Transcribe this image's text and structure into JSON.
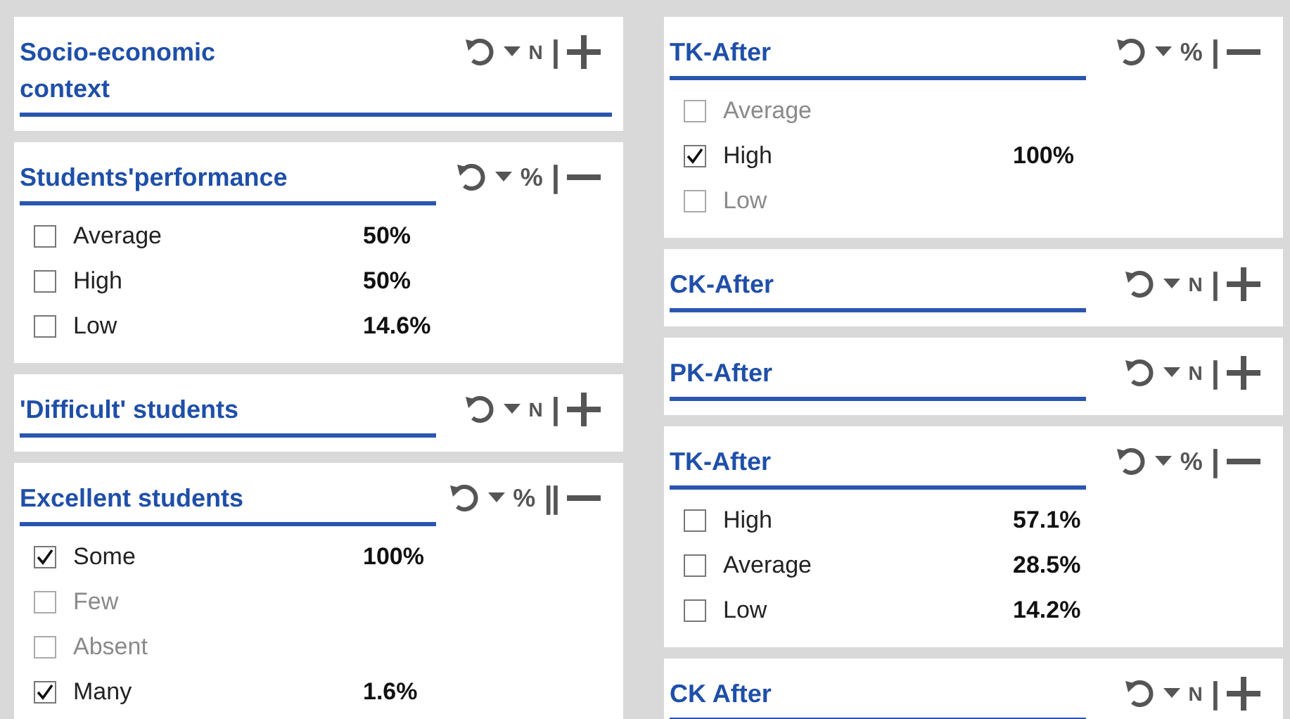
{
  "columns": [
    {
      "panels": [
        {
          "title": "Socio-economic context",
          "kind": "wrapped",
          "mode": "N",
          "separator": "|",
          "expanded": false
        },
        {
          "title": "Students'performance",
          "kind": "single",
          "mode": "%",
          "separator": "|",
          "expanded": true,
          "options": [
            {
              "label": "Average",
              "checked": false,
              "disabled": false,
              "value": "50%"
            },
            {
              "label": "High",
              "checked": false,
              "disabled": false,
              "value": "50%"
            },
            {
              "label": "Low",
              "checked": false,
              "disabled": false,
              "value": "14.6%"
            }
          ]
        },
        {
          "title": "'Difficult' students",
          "kind": "single",
          "mode": "N",
          "separator": "|",
          "expanded": false
        },
        {
          "title": "Excellent students",
          "kind": "single",
          "mode": "%",
          "separator": "||",
          "expanded": true,
          "options": [
            {
              "label": "Some",
              "checked": true,
              "disabled": false,
              "value": "100%"
            },
            {
              "label": "Few",
              "checked": false,
              "disabled": true
            },
            {
              "label": "Absent",
              "checked": false,
              "disabled": true
            },
            {
              "label": "Many",
              "checked": true,
              "disabled": false,
              "value": "1.6%"
            }
          ]
        }
      ]
    },
    {
      "panels": [
        {
          "title": "TK-After",
          "kind": "single",
          "mode": "%",
          "separator": "|",
          "expanded": true,
          "options": [
            {
              "label": "Average",
              "checked": false,
              "disabled": true
            },
            {
              "label": "High",
              "checked": true,
              "disabled": false,
              "value": "100%"
            },
            {
              "label": "Low",
              "checked": false,
              "disabled": true
            }
          ]
        },
        {
          "title": "CK-After",
          "kind": "single",
          "mode": "N",
          "separator": "|",
          "expanded": false
        },
        {
          "title": "PK-After",
          "kind": "single",
          "mode": "N",
          "separator": "|",
          "expanded": false
        },
        {
          "title": "TK-After",
          "kind": "single",
          "mode": "%",
          "separator": "|",
          "expanded": true,
          "options": [
            {
              "label": "High",
              "checked": false,
              "disabled": false,
              "value": "57.1%"
            },
            {
              "label": "Average",
              "checked": false,
              "disabled": false,
              "value": "28.5%"
            },
            {
              "label": "Low",
              "checked": false,
              "disabled": false,
              "value": "14.2%"
            }
          ]
        },
        {
          "title": "CK After",
          "kind": "single",
          "mode": "N",
          "separator": "|",
          "expanded": false
        }
      ]
    }
  ]
}
